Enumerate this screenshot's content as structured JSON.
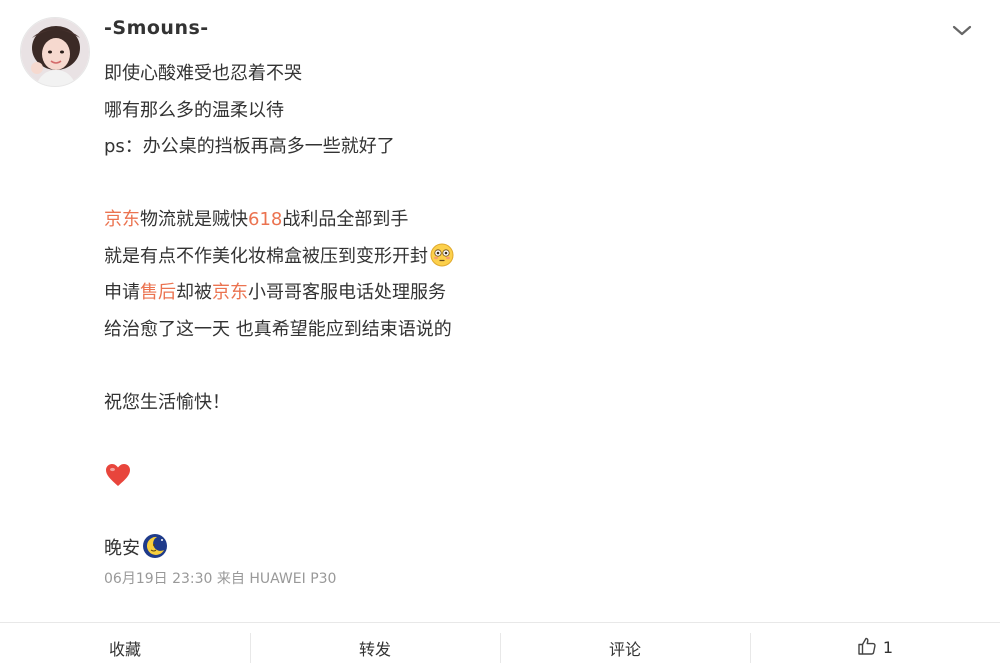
{
  "post": {
    "username": "-Smouns-",
    "lines_block1": [
      "即使心酸难受也忍着不哭",
      "哪有那么多的温柔以待",
      "ps：办公桌的挡板再高多一些就好了"
    ],
    "line4": {
      "link1": "京东",
      "text1": "物流就是贼快",
      "link2": "618",
      "text2": "战利品全部到手"
    },
    "line5": {
      "text": "就是有点不作美化妆棉盒被压到变形开封",
      "emoji": "flushed-face"
    },
    "line6": {
      "text1": "申请",
      "link1": "售后",
      "text2": "却被",
      "link2": "京东",
      "text3": "小哥哥客服电话处理服务"
    },
    "line7": "给治愈了这一天 也真希望能应到结束语说的",
    "line8": "祝您生活愉快！",
    "heart_emoji": "red-heart",
    "line9": {
      "text": "晚安",
      "emoji": "moon-face"
    },
    "meta": {
      "date": "06月19日 23:30",
      "source": "来自 HUAWEI P30"
    },
    "colors": {
      "link": "#eb7350",
      "text": "#333333",
      "meta": "#999999"
    }
  },
  "actions": {
    "favorite": "收藏",
    "repost": "转发",
    "comment": "评论",
    "like_count": "1"
  },
  "icons": {
    "menu": "chevron-down-icon",
    "like": "thumbs-up-icon"
  }
}
